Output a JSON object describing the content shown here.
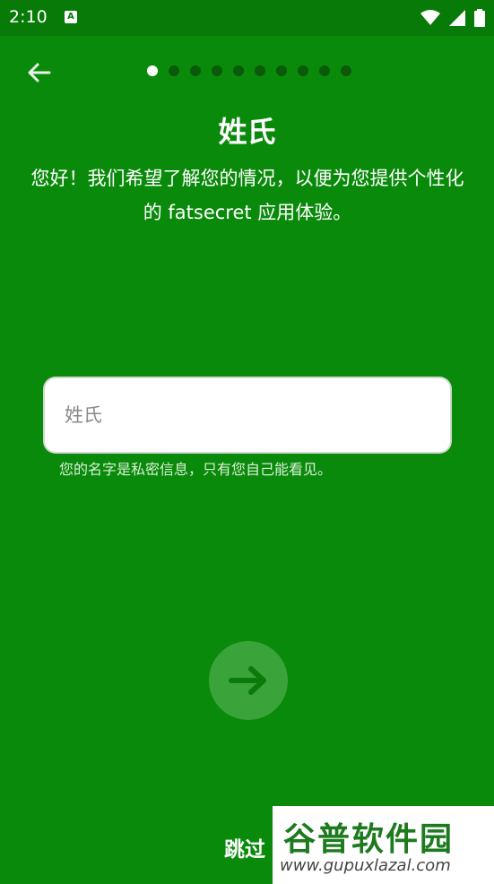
{
  "status_bar": {
    "time": "2:10",
    "notification_icon": "A"
  },
  "header": {
    "back_icon": "arrow-left-icon",
    "progress": {
      "total_steps": 10,
      "current_step": 1
    }
  },
  "content": {
    "title": "姓氏",
    "description": "您好！我们希望了解您的情况，以便为您提供个性化的 fatsecret 应用体验。",
    "input_placeholder": "姓氏",
    "input_value": "",
    "helper_text": "您的名字是私密信息，只有您自己能看见。"
  },
  "actions": {
    "next_icon": "arrow-right-icon",
    "skip_label": "跳过"
  },
  "watermark": {
    "logo_text": "谷普软件园",
    "url": "www.gupuxlazal.com"
  },
  "colors": {
    "background": "#0a8a0a",
    "status_bar": "#077a07",
    "dot_inactive": "#0a5a0a",
    "next_button": "#3aa43a"
  }
}
